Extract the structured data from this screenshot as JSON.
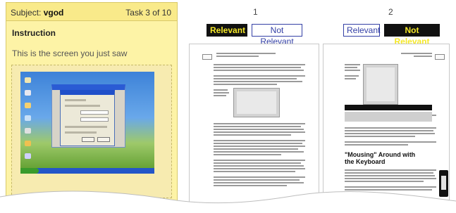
{
  "instruction_panel": {
    "subject_label": "Subject:",
    "subject_name": "vgod",
    "task_counter": "Task 3 of 10",
    "title": "Instruction",
    "text": "This is the screen you just saw"
  },
  "results": [
    {
      "number": "1",
      "relevant_label": "Relevant",
      "not_relevant_label": "Not Relevant",
      "selected": "relevant"
    },
    {
      "number": "2",
      "relevant_label": "Relevant",
      "not_relevant_label": "Not Relevant",
      "selected": "not_relevant"
    }
  ],
  "page2": {
    "heading_line1": "\"Mousing\" Around with",
    "heading_line2": "the Keyboard"
  },
  "colors": {
    "panel_bg": "#fdf3a6",
    "selected_bg": "#111111",
    "selected_text": "#f5e829",
    "unselected_text": "#3440a6"
  }
}
